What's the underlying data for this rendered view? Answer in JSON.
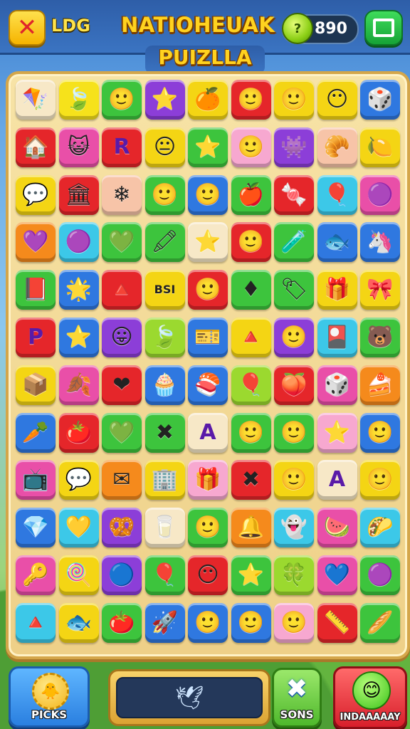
{
  "header": {
    "close_icon": "x-icon",
    "left_label": "LDG",
    "title": "NATIOHEUAK",
    "subtitle": "PUIZLLA",
    "coins": "890",
    "coin_icon": "coin-drop-icon",
    "menu_icon": "panel-icon"
  },
  "board": {
    "rows": [
      [
        {
          "g": "🪁",
          "c": "#f7e8c7"
        },
        {
          "g": "🍃",
          "c": "#f6e21b"
        },
        {
          "g": "🙂",
          "c": "#3dc43d"
        },
        {
          "g": "⭐",
          "c": "#8c3ed8"
        },
        {
          "g": "🍊",
          "c": "#f4d514"
        },
        {
          "g": "🙂",
          "c": "#e5262a"
        },
        {
          "g": "🙂",
          "c": "#f4d514"
        },
        {
          "g": "😶",
          "c": "#f4d514"
        },
        {
          "g": "🎲",
          "c": "#2f78e0"
        }
      ],
      [
        {
          "g": "🏠",
          "c": "#e5262a"
        },
        {
          "g": "😺",
          "c": "#e94fa8"
        },
        {
          "g": "R",
          "c": "#e5262a"
        },
        {
          "g": "😐",
          "c": "#f4d514"
        },
        {
          "g": "⭐",
          "c": "#3dc43d"
        },
        {
          "g": "🙂",
          "c": "#f7a8d0"
        },
        {
          "g": "👾",
          "c": "#8c3ed8"
        },
        {
          "g": "🥐",
          "c": "#f7c4a8"
        },
        {
          "g": "🍋",
          "c": "#f4d514"
        }
      ],
      [
        {
          "g": "💬",
          "c": "#f4d514"
        },
        {
          "g": "🏛",
          "c": "#e5262a"
        },
        {
          "g": "❄",
          "c": "#f7c4a8"
        },
        {
          "g": "🙂",
          "c": "#3dc43d"
        },
        {
          "g": "🙂",
          "c": "#2f78e0"
        },
        {
          "g": "🍎",
          "c": "#3dc43d"
        },
        {
          "g": "🍬",
          "c": "#e5262a"
        },
        {
          "g": "🎈",
          "c": "#3cc8e8"
        },
        {
          "g": "🟣",
          "c": "#e94fa8"
        }
      ],
      [
        {
          "g": "💜",
          "c": "#f58a1c"
        },
        {
          "g": "🟣",
          "c": "#3cc8e8"
        },
        {
          "g": "💚",
          "c": "#3dc43d"
        },
        {
          "g": "🖍",
          "c": "#3dc43d"
        },
        {
          "g": "⭐",
          "c": "#f7e8c7"
        },
        {
          "g": "🙂",
          "c": "#e5262a"
        },
        {
          "g": "🧪",
          "c": "#3dc43d"
        },
        {
          "g": "🐟",
          "c": "#2f78e0"
        },
        {
          "g": "🦄",
          "c": "#2f78e0"
        }
      ],
      [
        {
          "g": "📕",
          "c": "#3dc43d"
        },
        {
          "g": "🌟",
          "c": "#2f78e0"
        },
        {
          "g": "🔺",
          "c": "#e5262a"
        },
        {
          "g": "BSI",
          "c": "#f4d514"
        },
        {
          "g": "🙂",
          "c": "#e5262a"
        },
        {
          "g": "♦",
          "c": "#3dc43d"
        },
        {
          "g": "🏷",
          "c": "#3dc43d"
        },
        {
          "g": "🎁",
          "c": "#f4d514"
        },
        {
          "g": "🎀",
          "c": "#f4d514"
        }
      ],
      [
        {
          "g": "P",
          "c": "#e5262a"
        },
        {
          "g": "⭐",
          "c": "#2f78e0"
        },
        {
          "g": "😛",
          "c": "#8c3ed8"
        },
        {
          "g": "🍃",
          "c": "#9bd92f"
        },
        {
          "g": "🎫",
          "c": "#2f78e0"
        },
        {
          "g": "🔺",
          "c": "#f4d514"
        },
        {
          "g": "🙂",
          "c": "#8c3ed8"
        },
        {
          "g": "🎴",
          "c": "#3cc8e8"
        },
        {
          "g": "🐻",
          "c": "#3dc43d"
        }
      ],
      [
        {
          "g": "📦",
          "c": "#f4d514"
        },
        {
          "g": "🍂",
          "c": "#e94fa8"
        },
        {
          "g": "❤",
          "c": "#e5262a"
        },
        {
          "g": "🧁",
          "c": "#2f78e0"
        },
        {
          "g": "🍣",
          "c": "#2f78e0"
        },
        {
          "g": "🎈",
          "c": "#9bd92f"
        },
        {
          "g": "🍑",
          "c": "#e5262a"
        },
        {
          "g": "🎲",
          "c": "#e94fa8"
        },
        {
          "g": "🍰",
          "c": "#f58a1c"
        }
      ],
      [
        {
          "g": "🥕",
          "c": "#2f78e0"
        },
        {
          "g": "🍅",
          "c": "#e5262a"
        },
        {
          "g": "💚",
          "c": "#3dc43d"
        },
        {
          "g": "✖",
          "c": "#3dc43d"
        },
        {
          "g": "A",
          "c": "#f7e8c7"
        },
        {
          "g": "🙂",
          "c": "#3dc43d"
        },
        {
          "g": "🙂",
          "c": "#3dc43d"
        },
        {
          "g": "⭐",
          "c": "#f7a8d0"
        },
        {
          "g": "🙂",
          "c": "#2f78e0"
        }
      ],
      [
        {
          "g": "📺",
          "c": "#e94fa8"
        },
        {
          "g": "💬",
          "c": "#f4d514"
        },
        {
          "g": "✉",
          "c": "#f58a1c"
        },
        {
          "g": "🏢",
          "c": "#f4d514"
        },
        {
          "g": "🎁",
          "c": "#f7a8d0"
        },
        {
          "g": "✖",
          "c": "#e5262a"
        },
        {
          "g": "🙂",
          "c": "#f4d514"
        },
        {
          "g": "A",
          "c": "#f7e8c7"
        },
        {
          "g": "🙂",
          "c": "#f4d514"
        }
      ],
      [
        {
          "g": "💎",
          "c": "#2f78e0"
        },
        {
          "g": "💛",
          "c": "#3cc8e8"
        },
        {
          "g": "🥨",
          "c": "#8c3ed8"
        },
        {
          "g": "🥛",
          "c": "#f7e8c7"
        },
        {
          "g": "🙂",
          "c": "#3dc43d"
        },
        {
          "g": "🔔",
          "c": "#f58a1c"
        },
        {
          "g": "👻",
          "c": "#3cc8e8"
        },
        {
          "g": "🍉",
          "c": "#e94fa8"
        },
        {
          "g": "🌮",
          "c": "#3cc8e8"
        }
      ],
      [
        {
          "g": "🔑",
          "c": "#e94fa8"
        },
        {
          "g": "🍭",
          "c": "#f4d514"
        },
        {
          "g": "🔵",
          "c": "#8c3ed8"
        },
        {
          "g": "🎈",
          "c": "#3dc43d"
        },
        {
          "g": "😶",
          "c": "#e5262a"
        },
        {
          "g": "⭐",
          "c": "#3dc43d"
        },
        {
          "g": "🍀",
          "c": "#9bd92f"
        },
        {
          "g": "💙",
          "c": "#e94fa8"
        },
        {
          "g": "🟣",
          "c": "#3dc43d"
        }
      ],
      [
        {
          "g": "🔺",
          "c": "#3cc8e8"
        },
        {
          "g": "🐟",
          "c": "#f4d514"
        },
        {
          "g": "🍅",
          "c": "#3dc43d"
        },
        {
          "g": "🚀",
          "c": "#2f78e0"
        },
        {
          "g": "🙂",
          "c": "#2f78e0"
        },
        {
          "g": "🙂",
          "c": "#2f78e0"
        },
        {
          "g": "🙂",
          "c": "#f7a8d0"
        },
        {
          "g": "📏",
          "c": "#e5262a"
        },
        {
          "g": "🥖",
          "c": "#3dc43d"
        }
      ]
    ]
  },
  "footer": {
    "picks_label": "PICKS",
    "picks_icon": "gear-coin-icon",
    "slot_icon": "bird-icon",
    "sons_label": "SONS",
    "sons_icon": "x-cross-icon",
    "inda_label": "INDAAAAAY",
    "inda_icon": "smiley-icon"
  }
}
